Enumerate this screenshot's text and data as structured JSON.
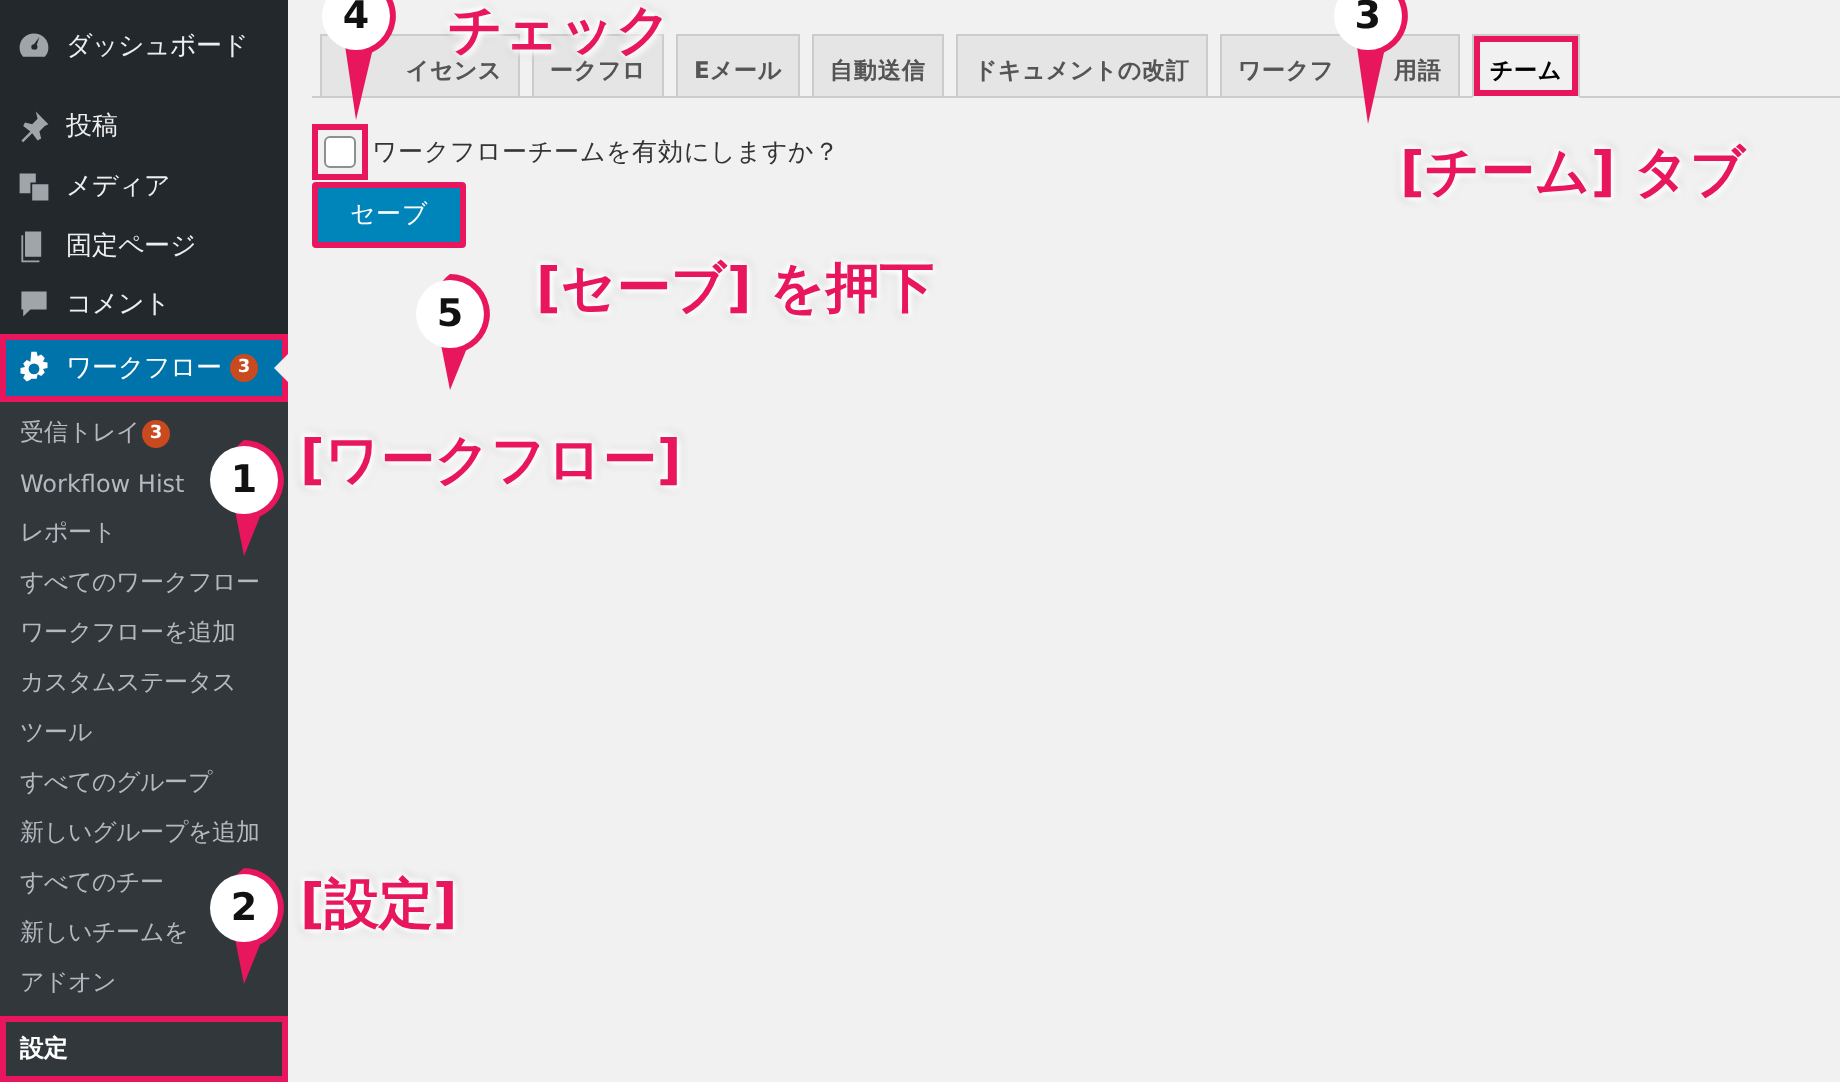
{
  "sidebar": {
    "items": [
      {
        "kind": "dashboard",
        "label": "ダッシュボード",
        "current": false,
        "highlighted": false
      },
      {
        "kind": "pin",
        "label": "投稿",
        "current": false,
        "highlighted": false
      },
      {
        "kind": "media",
        "label": "メディア",
        "current": false,
        "highlighted": false
      },
      {
        "kind": "page",
        "label": "固定ページ",
        "current": false,
        "highlighted": false
      },
      {
        "kind": "comment",
        "label": "コメント",
        "current": false,
        "highlighted": false
      },
      {
        "kind": "gear",
        "label": "ワークフロー",
        "badge": "3",
        "current": true,
        "highlighted": true
      }
    ],
    "submenu": [
      {
        "label": "受信トレイ",
        "badge": "3",
        "selected": false,
        "highlighted": false
      },
      {
        "label": "Workflow Hist",
        "selected": false,
        "highlighted": false
      },
      {
        "label": "レポート",
        "selected": false,
        "highlighted": false
      },
      {
        "label": "すべてのワークフロー",
        "selected": false,
        "highlighted": false
      },
      {
        "label": "ワークフローを追加",
        "selected": false,
        "highlighted": false
      },
      {
        "label": "カスタムステータス",
        "selected": false,
        "highlighted": false
      },
      {
        "label": "ツール",
        "selected": false,
        "highlighted": false
      },
      {
        "label": "すべてのグループ",
        "selected": false,
        "highlighted": false
      },
      {
        "label": "新しいグループを追加",
        "selected": false,
        "highlighted": false
      },
      {
        "label": "すべてのチー",
        "selected": false,
        "highlighted": false
      },
      {
        "label": "新しいチームを",
        "selected": false,
        "highlighted": false
      },
      {
        "label": "アドオン",
        "selected": false,
        "highlighted": false
      },
      {
        "label": "設定",
        "selected": true,
        "highlighted": true
      }
    ]
  },
  "tabs": [
    {
      "label": "イセンス",
      "selected": false,
      "highlighted": false
    },
    {
      "label": "ークフロ",
      "selected": false,
      "highlighted": false
    },
    {
      "label": "Eメール",
      "selected": false,
      "highlighted": false
    },
    {
      "label": "自動送信",
      "selected": false,
      "highlighted": false
    },
    {
      "label": "ドキュメントの改訂",
      "selected": false,
      "highlighted": false
    },
    {
      "label": "ワークフ",
      "label_end": "用語",
      "selected": false,
      "highlighted": false
    },
    {
      "label": "チーム",
      "selected": true,
      "highlighted": true
    }
  ],
  "form": {
    "checkbox": {
      "label": "ワークフローチームを有効にしますか？",
      "checked": false,
      "highlighted": true
    },
    "save_button": {
      "label": "セーブ",
      "highlighted": true
    }
  },
  "annotations": [
    {
      "number": "4",
      "label": "チェック"
    },
    {
      "number": "3",
      "label": "[チーム] タブ"
    },
    {
      "number": "5",
      "label": "[セーブ] を押下"
    },
    {
      "number": "1",
      "label": "[ワークフロー]"
    },
    {
      "number": "2",
      "label": "[設定]"
    }
  ]
}
